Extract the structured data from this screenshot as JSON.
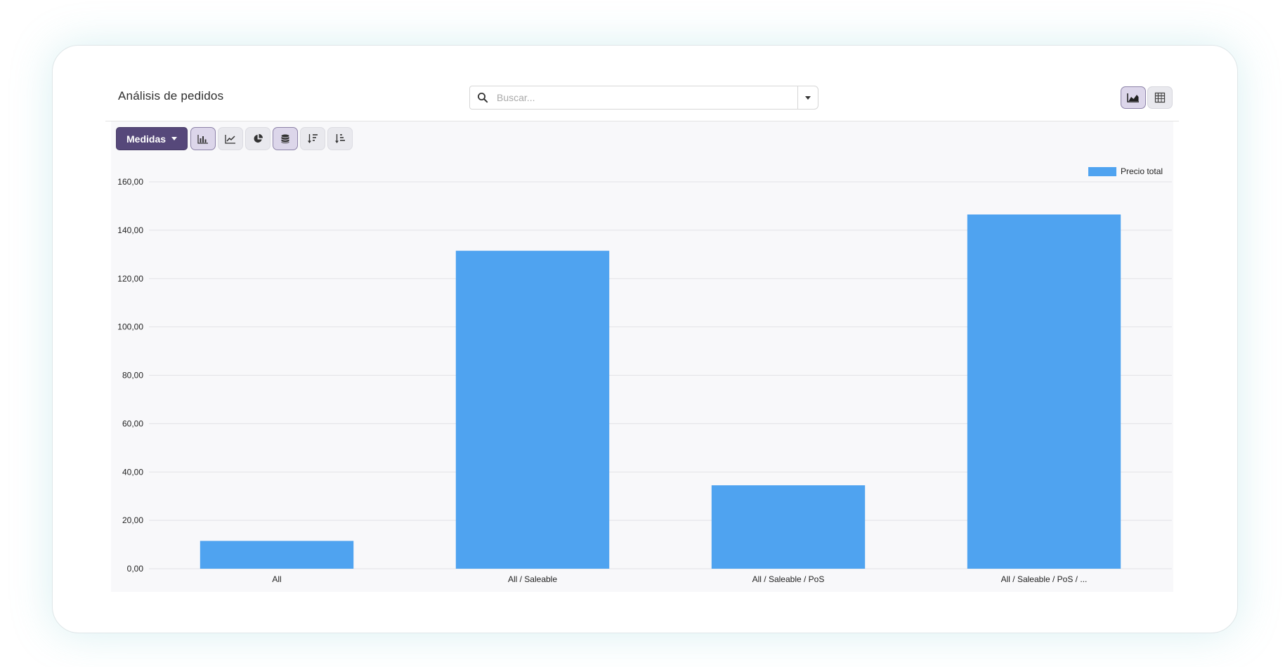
{
  "header": {
    "title": "Análisis de pedidos",
    "search_placeholder": "Buscar...",
    "search_value": ""
  },
  "toolbar": {
    "measures_label": "Medidas",
    "buttons": [
      "bar-chart-icon",
      "line-chart-icon",
      "pie-chart-icon",
      "database-icon",
      "sort-descending-icon",
      "sort-ascending-icon"
    ],
    "active": [
      "bar-chart-icon",
      "database-icon"
    ]
  },
  "view_switcher": {
    "buttons": [
      "graph-view-icon",
      "pivot-table-icon"
    ],
    "active": "graph-view-icon"
  },
  "colors": {
    "accent": "#56487a",
    "bar": "#4fa3f0"
  },
  "chart_data": {
    "type": "bar",
    "categories": [
      "All",
      "All / Saleable",
      "All / Saleable / PoS",
      "All / Saleable / PoS / ..."
    ],
    "series": [
      {
        "name": "Precio total",
        "values": [
          11.5,
          131.5,
          34.5,
          146.5
        ]
      }
    ],
    "yticks": [
      "0,00",
      "20,00",
      "40,00",
      "60,00",
      "80,00",
      "100,00",
      "120,00",
      "140,00",
      "160,00"
    ],
    "ylim": [
      0,
      160
    ],
    "grid": true,
    "legend": "top-right"
  }
}
